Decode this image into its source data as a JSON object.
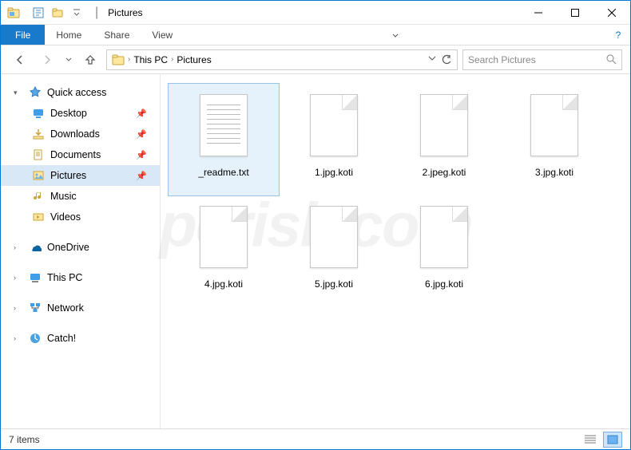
{
  "window": {
    "title": "Pictures"
  },
  "ribbon": {
    "file": "File",
    "tabs": [
      "Home",
      "Share",
      "View"
    ]
  },
  "breadcrumb": {
    "items": [
      "This PC",
      "Pictures"
    ]
  },
  "search": {
    "placeholder": "Search Pictures"
  },
  "sidebar": {
    "quick_access": {
      "label": "Quick access",
      "items": [
        {
          "label": "Desktop",
          "icon": "desktop",
          "pinned": true
        },
        {
          "label": "Downloads",
          "icon": "downloads",
          "pinned": true
        },
        {
          "label": "Documents",
          "icon": "documents",
          "pinned": true
        },
        {
          "label": "Pictures",
          "icon": "pictures",
          "pinned": true,
          "selected": true
        },
        {
          "label": "Music",
          "icon": "music",
          "pinned": false
        },
        {
          "label": "Videos",
          "icon": "videos",
          "pinned": false
        }
      ]
    },
    "extra": [
      {
        "label": "OneDrive",
        "icon": "onedrive"
      },
      {
        "label": "This PC",
        "icon": "thispc"
      },
      {
        "label": "Network",
        "icon": "network"
      },
      {
        "label": "Catch!",
        "icon": "catch"
      }
    ]
  },
  "files": [
    {
      "label": "_readme.txt",
      "type": "text",
      "selected": true
    },
    {
      "label": "1.jpg.koti",
      "type": "blank"
    },
    {
      "label": "2.jpeg.koti",
      "type": "blank"
    },
    {
      "label": "3.jpg.koti",
      "type": "blank"
    },
    {
      "label": "4.jpg.koti",
      "type": "blank"
    },
    {
      "label": "5.jpg.koti",
      "type": "blank"
    },
    {
      "label": "6.jpg.koti",
      "type": "blank"
    }
  ],
  "status": {
    "count_label": "7 items"
  },
  "colors": {
    "accent": "#1979ca",
    "selection": "#d9e8f7"
  },
  "watermark": "pcrisk.com"
}
